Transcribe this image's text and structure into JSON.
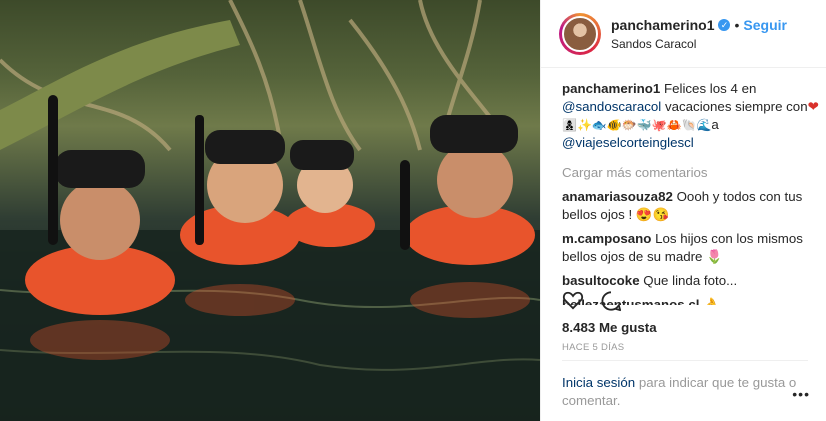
{
  "header": {
    "username": "panchamerino1",
    "verified_icon": "✓",
    "separator": "•",
    "follow_label": "Seguir",
    "location": "Sandos Caracol"
  },
  "caption": {
    "user": "panchamerino1",
    "text_1": "Felices los 4 en",
    "mention_1": "@sandoscaracol",
    "text_2": "vacaciones siempre con",
    "heart": "❤",
    "emojis": "👩‍👦‍👦✨🐟🐠🐡🐳🐙🦀🐚🌊",
    "text_3": "a",
    "mention_2": "@viajeselcorteinglescl"
  },
  "load_more_label": "Cargar más comentarios",
  "comments": [
    {
      "user": "anamariasouza82",
      "text": "Oooh y todos con tus bellos ojos ! 😍😘"
    },
    {
      "user": "m.camposano",
      "text": "Los hijos con los mismos bellos ojos de su madre 🌷"
    },
    {
      "user": "basultocoke",
      "text": "Que linda foto..."
    },
    {
      "user": "bellezaentusmanos.cl",
      "text": "👌"
    }
  ],
  "likes_label": "8.483 Me gusta",
  "timestamp": "HACE 5 DÍAS",
  "login": {
    "link": "Inicia sesión",
    "text": "para indicar que te gusta o comentar."
  },
  "more_icon": "•••",
  "colors": {
    "link": "#003569",
    "follow": "#3897f0",
    "muted": "#999999"
  }
}
